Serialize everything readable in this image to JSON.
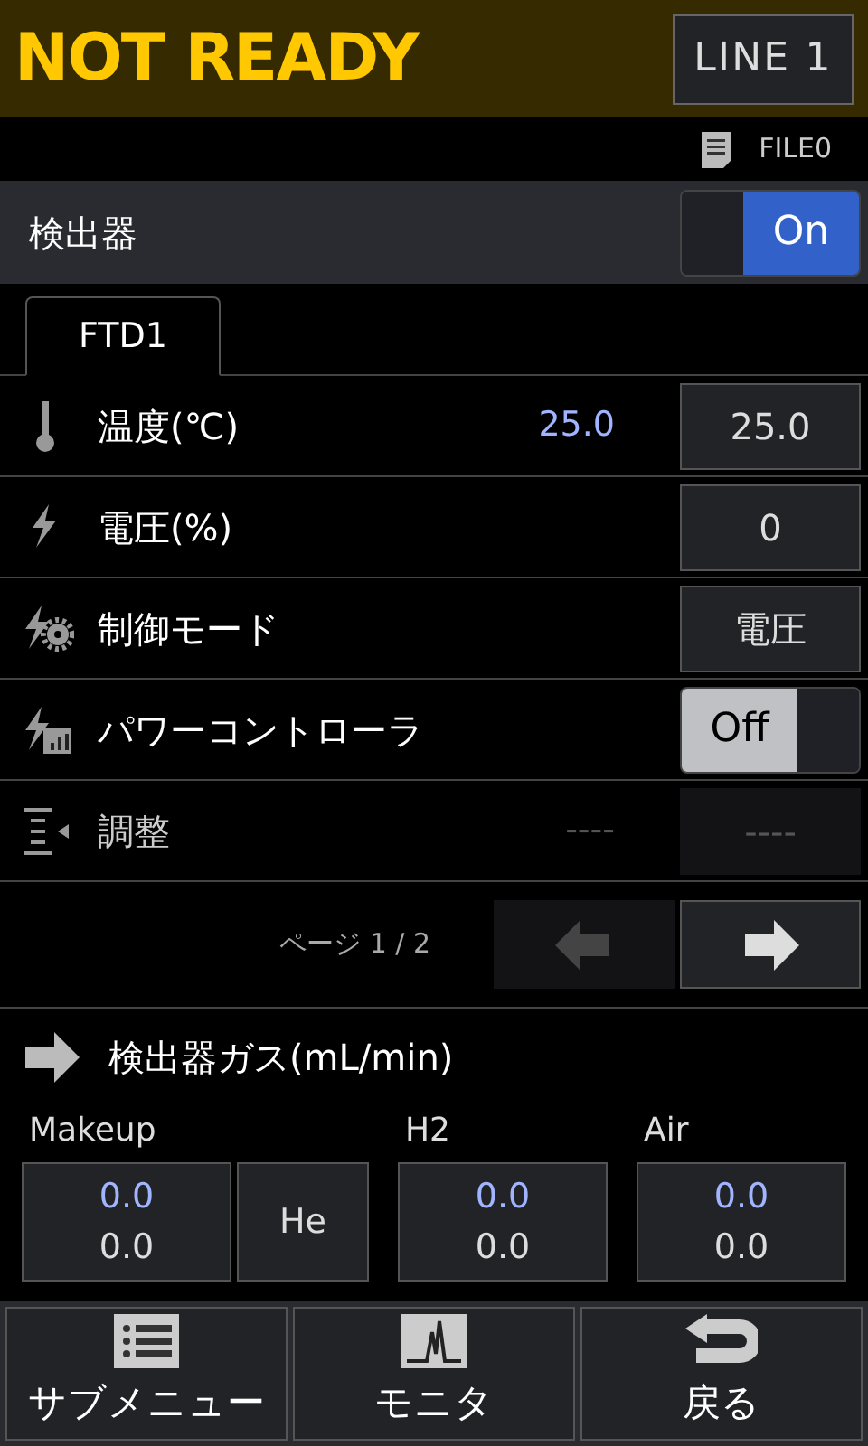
{
  "status": "NOT READY",
  "line_button": "LINE 1",
  "file": "FILE0",
  "detector": {
    "label": "検出器",
    "on": true,
    "toggle_text": "On"
  },
  "tabs": [
    {
      "label": "FTD1",
      "selected": true
    }
  ],
  "params": [
    {
      "kind": "value",
      "label": "温度(℃)",
      "actual": "25.0",
      "setting": "25.0",
      "disabled": false
    },
    {
      "kind": "value",
      "label": "電圧(%)",
      "setting": "0",
      "disabled": false
    },
    {
      "kind": "value",
      "label": "制御モード",
      "setting": "電圧",
      "disabled": false
    },
    {
      "kind": "toggle",
      "label": "パワーコントローラ",
      "on": false,
      "toggle_text": "Off",
      "disabled": false
    },
    {
      "kind": "value",
      "label": "調整",
      "actual": "----",
      "setting": "----",
      "disabled": true
    }
  ],
  "pager": {
    "text": "ページ 1 / 2",
    "prev_disabled": true,
    "next_disabled": false
  },
  "gas": {
    "title": "検出器ガス(mL/min)",
    "channels": [
      {
        "label": "Makeup",
        "actual": "0.0",
        "setting": "0.0",
        "gas_type": "He"
      },
      {
        "label": "H2",
        "actual": "0.0",
        "setting": "0.0"
      },
      {
        "label": "Air",
        "actual": "0.0",
        "setting": "0.0"
      }
    ]
  },
  "footer": [
    "サブメニュー",
    "モニタ",
    "戻る"
  ]
}
